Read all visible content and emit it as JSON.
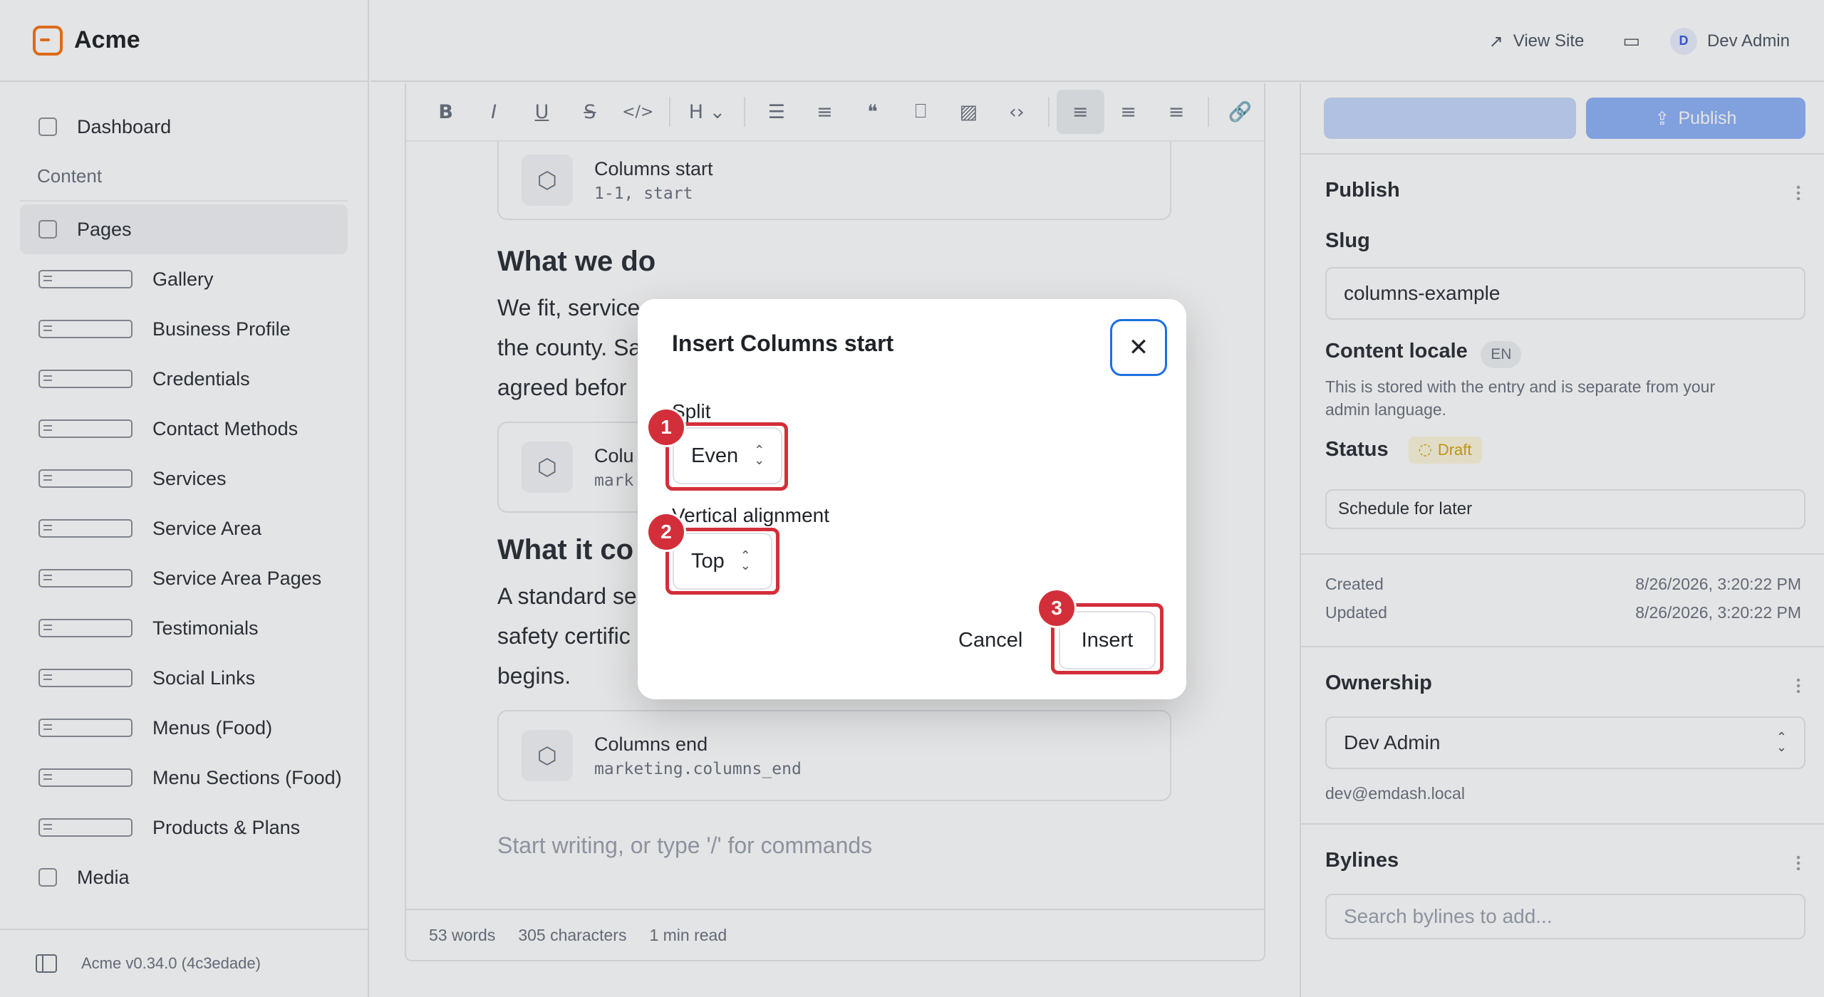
{
  "app": {
    "name": "Acme",
    "version": "Acme v0.34.0 (4c3edade)"
  },
  "topbar": {
    "view_site": "View Site",
    "user_initial": "D",
    "user_name": "Dev Admin"
  },
  "sidebar": {
    "dashboard": "Dashboard",
    "section_content": "Content",
    "items": [
      {
        "label": "Pages"
      },
      {
        "label": "Gallery"
      },
      {
        "label": "Business Profile"
      },
      {
        "label": "Credentials"
      },
      {
        "label": "Contact Methods"
      },
      {
        "label": "Services"
      },
      {
        "label": "Service Area"
      },
      {
        "label": "Service Area Pages"
      },
      {
        "label": "Testimonials"
      },
      {
        "label": "Social Links"
      },
      {
        "label": "Menus (Food)"
      },
      {
        "label": "Menu Sections (Food)"
      },
      {
        "label": "Products & Plans"
      },
      {
        "label": "Media"
      }
    ]
  },
  "editor": {
    "block1": {
      "title": "Columns start",
      "sub": "1-1, start"
    },
    "heading1": "What we do",
    "para1": [
      "We fit, service",
      "the county. Sa",
      "agreed befor"
    ],
    "block2": {
      "title": "Colu",
      "sub": "mark"
    },
    "heading2": "What it co",
    "para2": [
      "A standard se",
      "safety certific",
      "begins."
    ],
    "block3": {
      "title": "Columns end",
      "sub": "marketing.columns_end"
    },
    "placeholder": "Start writing, or type '/' for commands",
    "status": {
      "words": "53 words",
      "chars": "305 characters",
      "read": "1 min read"
    }
  },
  "panel": {
    "publish_button": "Publish",
    "publish_heading": "Publish",
    "slug_label": "Slug",
    "slug_value": "columns-example",
    "locale_label": "Content locale",
    "locale_badge": "EN",
    "locale_hint_1": "This is stored with the entry and is separate from your",
    "locale_hint_2": "admin language.",
    "status_label": "Status",
    "status_value": "Draft",
    "schedule_button": "Schedule for later",
    "created_label": "Created",
    "created_value": "8/26/2026, 3:20:22 PM",
    "updated_label": "Updated",
    "updated_value": "8/26/2026, 3:20:22 PM",
    "ownership_heading": "Ownership",
    "owner_value": "Dev Admin",
    "owner_email": "dev@emdash.local",
    "bylines_heading": "Bylines",
    "bylines_placeholder": "Search bylines to add..."
  },
  "modal": {
    "title": "Insert Columns start",
    "split_label": "Split",
    "split_value": "Even",
    "valign_label": "Vertical alignment",
    "valign_value": "Top",
    "cancel": "Cancel",
    "insert": "Insert"
  },
  "annotations": {
    "n1": "1",
    "n2": "2",
    "n3": "3"
  },
  "colors": {
    "accent": "#1d6fe0",
    "highlight": "#d32f3a",
    "brand": "#f97316",
    "publish": "#8fb1f7"
  }
}
